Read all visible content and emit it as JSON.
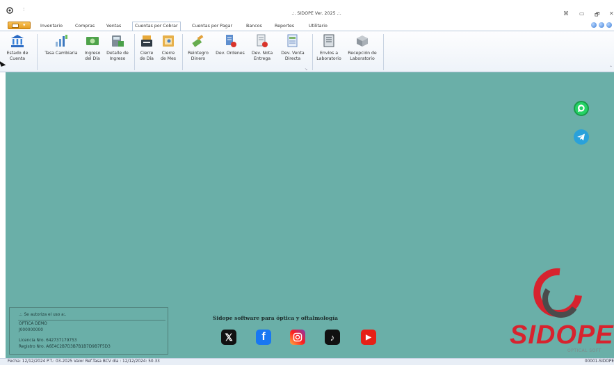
{
  "window": {
    "title": ".:. SIDOPE Ver. 2025 .:.",
    "quick_access": ":",
    "buttons": [
      "⌘",
      "▭",
      "🗗",
      "✕"
    ]
  },
  "menu": {
    "tabs": [
      "Inventario",
      "Compras",
      "Ventas",
      "Cuentas por Cobrar",
      "Cuentas por Pagar",
      "Bancos",
      "Reportes",
      "Utilitario"
    ],
    "active_tab": "Cuentas por Cobrar"
  },
  "ribbon": {
    "buttons": [
      {
        "label": "Estado de\nCuenta",
        "icon": "bank-icon"
      },
      {
        "label": "Tasa Cambiaria",
        "icon": "exchange-rate-icon"
      },
      {
        "label": "Ingreso\ndel Día",
        "icon": "cash-icon"
      },
      {
        "label": "Detalle de\nIngreso",
        "icon": "calculator-icon"
      },
      {
        "label": "Cierre\nde Día",
        "icon": "cash-register-icon"
      },
      {
        "label": "Cierre\nde Mes",
        "icon": "calendar-icon"
      },
      {
        "label": "Reintegro\nDinero",
        "icon": "refund-icon"
      },
      {
        "label": "Dev. Ordenes",
        "icon": "return-orders-icon"
      },
      {
        "label": "Dev. Nota\nEntrega",
        "icon": "return-note-icon"
      },
      {
        "label": "Dev. Venta\nDirecta",
        "icon": "return-sale-icon"
      },
      {
        "label": "Envíos a\nLaboratorio",
        "icon": "shipping-icon"
      },
      {
        "label": "Recepción de\nLaboratorio",
        "icon": "receive-box-icon"
      }
    ]
  },
  "license": {
    "heading": ".:. Se autoriza el uso a:.",
    "company": "OPTICA DEMO",
    "company_id": "J000000000",
    "license_no": "Licencia Nro. 642737179753",
    "registry_no": "Registro Nro. A6E4C2B7D3B7B1B7D9B7F5D3"
  },
  "promo": {
    "tagline": "Sidope software para óptica y oftalmología",
    "socials": [
      "x-icon",
      "facebook-icon",
      "instagram-icon",
      "tiktok-icon",
      "youtube-icon"
    ]
  },
  "side_social": [
    "whatsapp-icon",
    "telegram-icon"
  ],
  "logo": {
    "name": "SIDOPE",
    "subtitle": "OPTICAL SOFT"
  },
  "status_bar": {
    "left": "Fecha:  12/12/2024   P.T.: 03-2025   Valor Ref.Tasa BCV día  :  12/12/2024:  50.33",
    "right": "00001-SIDOPE"
  },
  "colors": {
    "workspace": "#6aafa8",
    "brand_red": "#d7232e",
    "ribbon_bg": "#eef3f9"
  }
}
